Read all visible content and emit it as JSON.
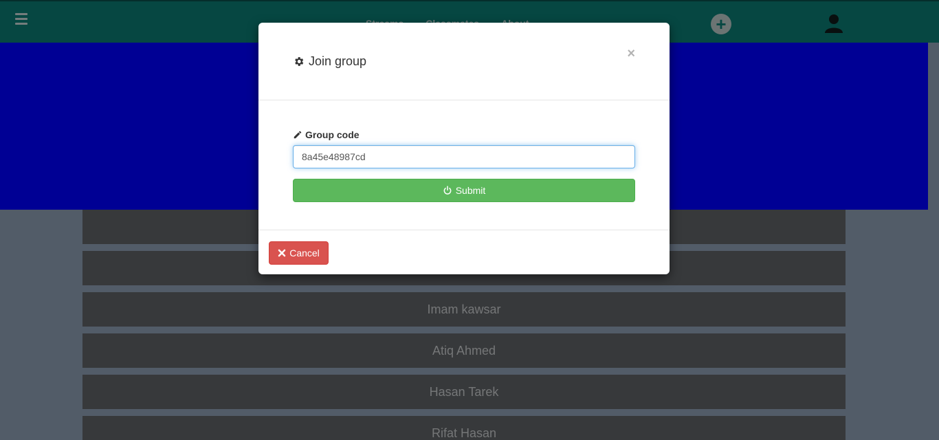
{
  "navbar": {
    "links": [
      "Streams",
      "Classmates",
      "About"
    ],
    "menu_icon": "hamburger-icon",
    "add_icon": "plus-circle-icon",
    "user_icon": "user-icon"
  },
  "list": {
    "items": [
      "",
      "",
      "Imam kawsar",
      "Atiq Ahmed",
      "Hasan Tarek",
      "Rifat Hasan"
    ]
  },
  "modal": {
    "title": "Join group",
    "title_icon": "gear-icon",
    "close_label": "×",
    "field_label": "Group code",
    "field_icon": "pencil-icon",
    "group_code_value": "8a45e48987cd",
    "submit_label": "Submit",
    "submit_icon": "power-icon",
    "cancel_label": "Cancel",
    "cancel_icon": "times-icon"
  },
  "colors": {
    "navbar": "#0b7a72",
    "banner": "#0000ff",
    "submit": "#5cb85c",
    "cancel": "#d9534f"
  }
}
